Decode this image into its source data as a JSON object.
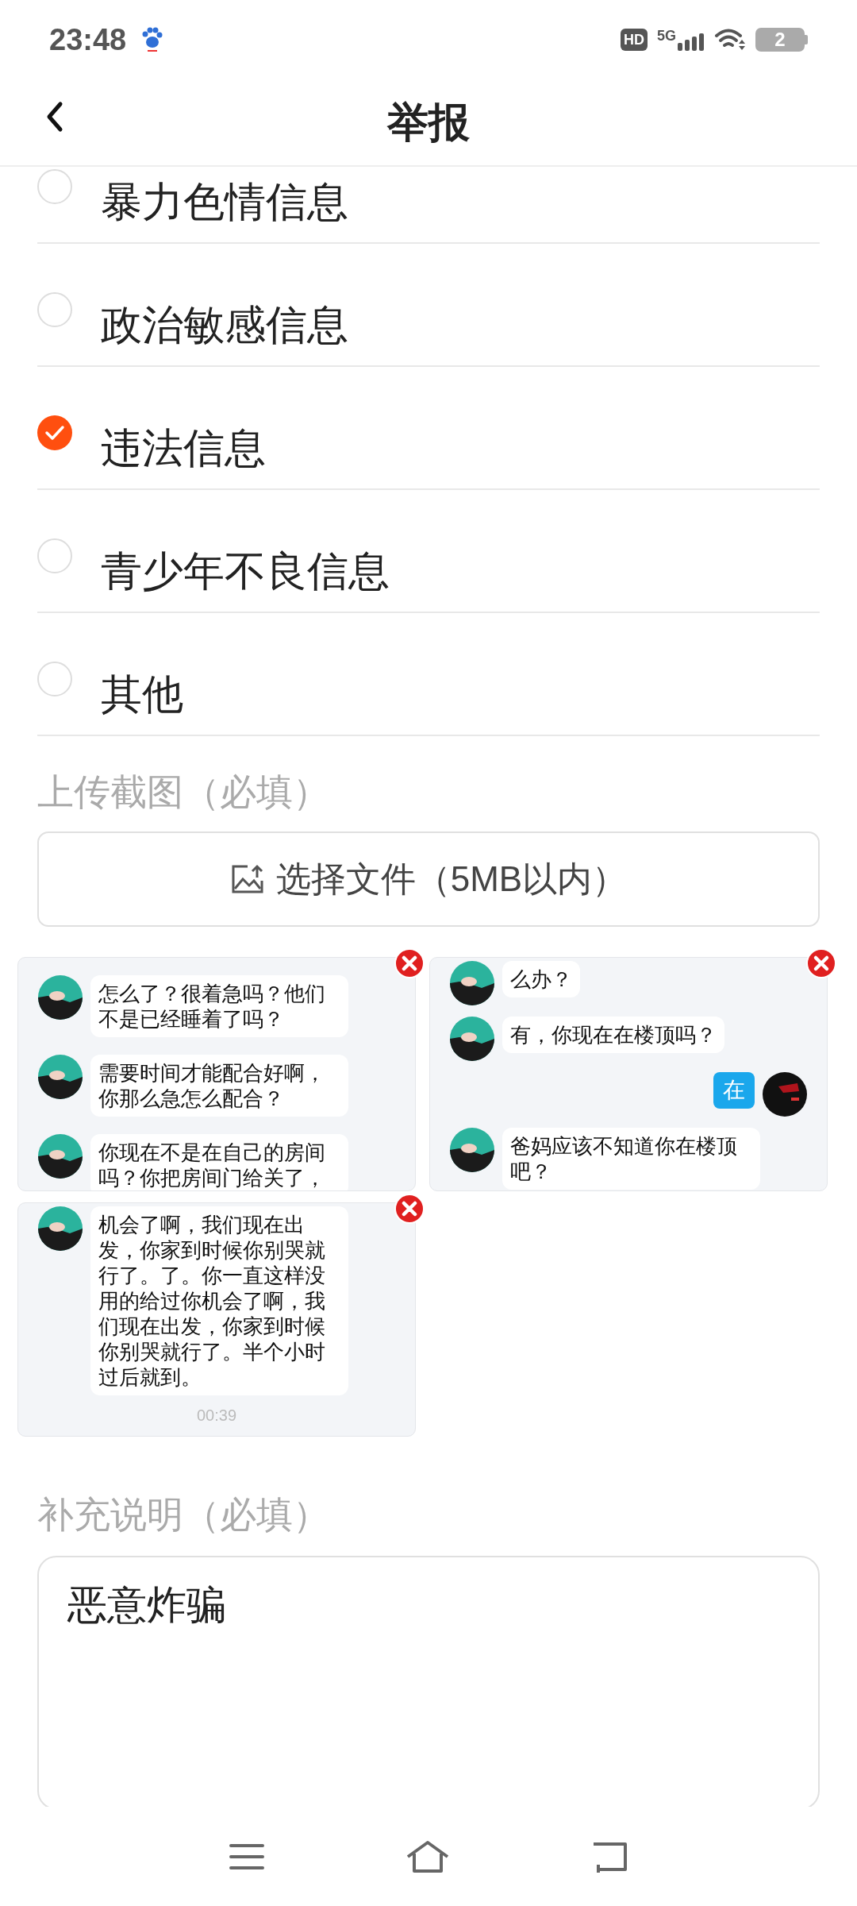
{
  "status_bar": {
    "time": "23:48",
    "hd": "HD",
    "network": "5G",
    "battery": "2"
  },
  "header": {
    "title": "举报"
  },
  "options": [
    {
      "label": "暴力色情信息",
      "selected": false
    },
    {
      "label": "政治敏感信息",
      "selected": false
    },
    {
      "label": "违法信息",
      "selected": true
    },
    {
      "label": "青少年不良信息",
      "selected": false
    },
    {
      "label": "其他",
      "selected": false
    }
  ],
  "upload": {
    "label": "上传截图（必填）",
    "button": "选择文件（5MB以内）"
  },
  "screenshots": [
    {
      "messages": [
        {
          "kind": "received",
          "text": "怎么了？很着急吗？他们不是已经睡着了吗？"
        },
        {
          "kind": "received",
          "text": "需要时间才能配合好啊，你那么急怎么配合？"
        },
        {
          "kind": "received",
          "text": "你现在不是在自己的房间吗？你把房间门给关了，"
        }
      ]
    },
    {
      "messages": [
        {
          "kind": "received",
          "text": "么办？"
        },
        {
          "kind": "received",
          "text": "有，你现在在楼顶吗？"
        },
        {
          "kind": "sent",
          "text": "在"
        },
        {
          "kind": "received",
          "text": "爸妈应该不知道你在楼顶吧？"
        }
      ]
    },
    {
      "messages": [
        {
          "kind": "received",
          "text": "机会了啊，我们现在出发，你家到时候你别哭就行了。了。你一直这样没用的给过你机会了啊，我们现在出发，你家到时候你别哭就行了。半个小时过后就到。"
        }
      ],
      "time": "00:39"
    }
  ],
  "note": {
    "label": "补充说明（必填）",
    "value": "恶意炸骗"
  }
}
